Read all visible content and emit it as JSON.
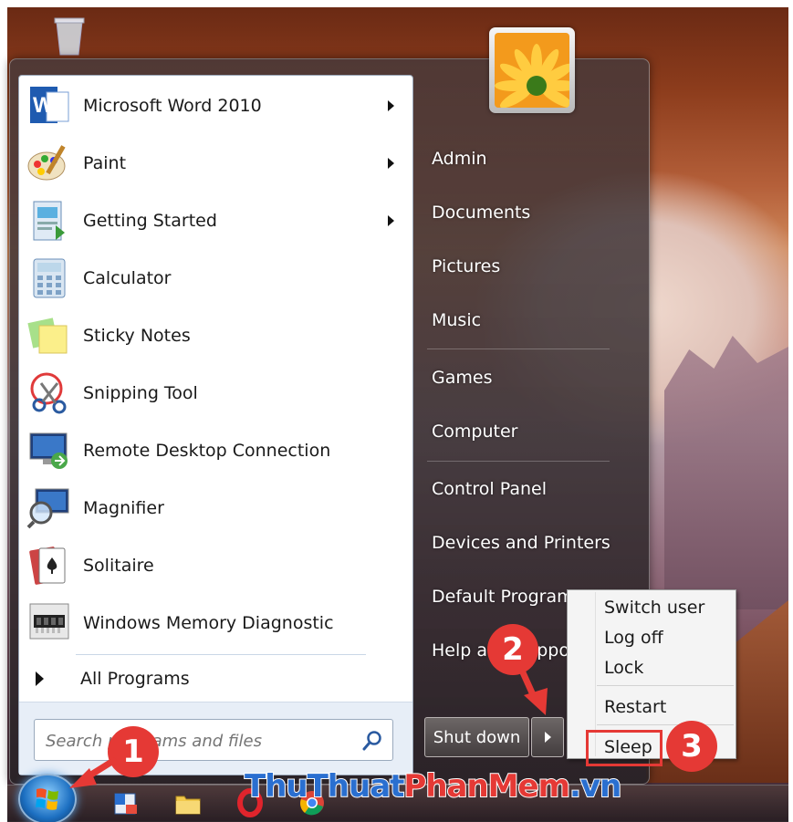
{
  "start_menu": {
    "programs": [
      {
        "label": "Microsoft Word 2010",
        "icon": "word-icon",
        "has_submenu": true
      },
      {
        "label": "Paint",
        "icon": "paint-icon",
        "has_submenu": true
      },
      {
        "label": "Getting Started",
        "icon": "getting-started-icon",
        "has_submenu": true
      },
      {
        "label": "Calculator",
        "icon": "calculator-icon",
        "has_submenu": false
      },
      {
        "label": "Sticky Notes",
        "icon": "sticky-notes-icon",
        "has_submenu": false
      },
      {
        "label": "Snipping Tool",
        "icon": "snipping-tool-icon",
        "has_submenu": false
      },
      {
        "label": "Remote Desktop Connection",
        "icon": "remote-desktop-icon",
        "has_submenu": false
      },
      {
        "label": "Magnifier",
        "icon": "magnifier-icon",
        "has_submenu": false
      },
      {
        "label": "Solitaire",
        "icon": "solitaire-icon",
        "has_submenu": false
      },
      {
        "label": "Windows Memory Diagnostic",
        "icon": "memory-diagnostic-icon",
        "has_submenu": false
      }
    ],
    "all_programs": "All Programs",
    "search": {
      "placeholder": "Search programs and files"
    },
    "right_items": [
      "Admin",
      "Documents",
      "Pictures",
      "Music",
      "Games",
      "Computer",
      "Control Panel",
      "Devices and Printers",
      "Default Programs",
      "Help and Support"
    ],
    "shutdown": {
      "label": "Shut down"
    },
    "power_menu": [
      "Switch user",
      "Log off",
      "Lock",
      "Restart",
      "Sleep"
    ]
  },
  "annotations": {
    "step1": "1",
    "step2": "2",
    "step3": "3"
  },
  "watermark": {
    "part1": "ThuThuat",
    "part2": "PhanMem",
    "part3": ".vn"
  },
  "colors": {
    "highlight": "#e53935",
    "menu_panel": "#ffffff",
    "right_pane": "#3e3436"
  }
}
